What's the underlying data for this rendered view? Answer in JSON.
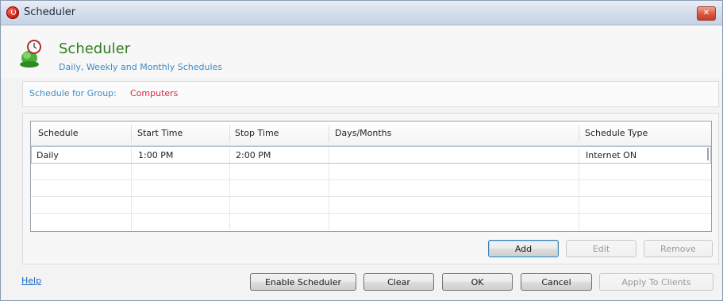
{
  "window": {
    "title": "Scheduler",
    "close_label": "✕"
  },
  "header": {
    "title": "Scheduler",
    "subtitle": "Daily, Weekly and Monthly Schedules"
  },
  "group": {
    "label": "Schedule for Group:",
    "value": "Computers"
  },
  "grid": {
    "columns": [
      "Schedule",
      "Start Time",
      "Stop Time",
      "Days/Months",
      "Schedule Type"
    ],
    "rows": [
      [
        "Daily",
        "1:00 PM",
        "2:00 PM",
        "",
        "Internet ON"
      ]
    ]
  },
  "grid_buttons": {
    "add": "Add",
    "edit": "Edit",
    "remove": "Remove"
  },
  "footer": {
    "help": "Help",
    "enable_scheduler": "Enable Scheduler",
    "clear": "Clear",
    "ok": "OK",
    "cancel": "Cancel",
    "apply_to_clients": "Apply To Clients"
  },
  "icons": {
    "app": "red-circle-app-icon",
    "header": "globe-clock-icon",
    "close": "close-icon"
  },
  "colors": {
    "title_green": "#2f7f1f",
    "link_blue": "#3d8cc4",
    "group_red": "#d7263d"
  }
}
